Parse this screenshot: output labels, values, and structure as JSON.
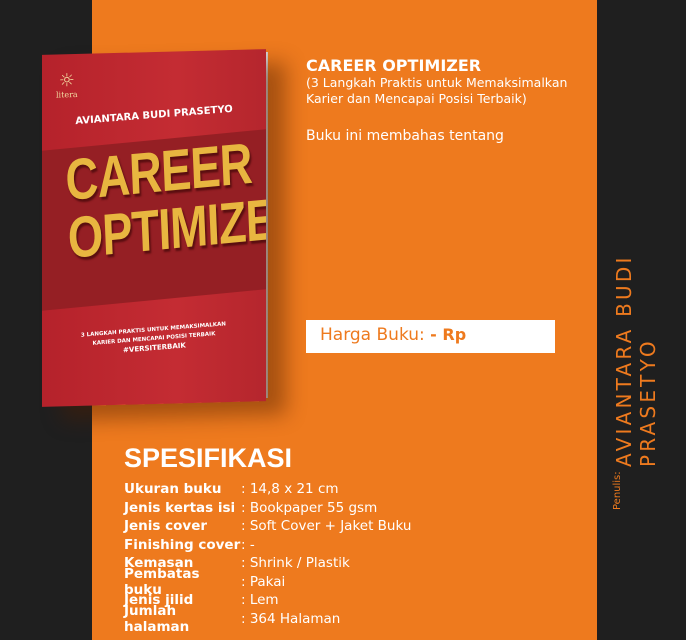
{
  "book_cover": {
    "publisher": "litera",
    "author": "AVIANTARA BUDI PRASETYO",
    "title_line1": "CAREER",
    "title_line2": "OPTIMIZER",
    "subtitle_line1": "3 LANGKAH PRAKTIS UNTUK MEMAKSIMALKAN",
    "subtitle_line2": "KARIER DAN MENCAPAI POSISI TERBAIK",
    "hashtag": "#VERSITERBAIK"
  },
  "header": {
    "title": "CAREER OPTIMIZER",
    "subtitle": "(3 Langkah Praktis untuk Memaksimalkan Karier dan Mencapai Posisi Terbaik)",
    "description": "Buku ini membahas tentang"
  },
  "price": {
    "label": "Harga Buku: ",
    "value": "- Rp"
  },
  "specs": {
    "heading": "SPESIFIKASI",
    "rows": [
      {
        "k": "Ukuran buku",
        "v": ": 14,8 x 21 cm"
      },
      {
        "k": "Jenis kertas isi",
        "v": ": Bookpaper 55 gsm"
      },
      {
        "k": "Jenis cover",
        "v": ": Soft Cover + Jaket Buku"
      },
      {
        "k": "Finishing cover",
        "v": ": -"
      },
      {
        "k": "Kemasan",
        "v": ": Shrink / Plastik"
      },
      {
        "k": "Pembatas buku",
        "v": ": Pakai"
      },
      {
        "k": "Jenis jilid",
        "v": ": Lem"
      },
      {
        "k": "Jumlah halaman",
        "v": ": 364 Halaman"
      }
    ]
  },
  "author_side": {
    "label": "Penulis:",
    "name": "AVIANTARA BUDI PRASETYO"
  },
  "colors": {
    "orange": "#ee7a1e",
    "dark": "#1f1f1f"
  }
}
